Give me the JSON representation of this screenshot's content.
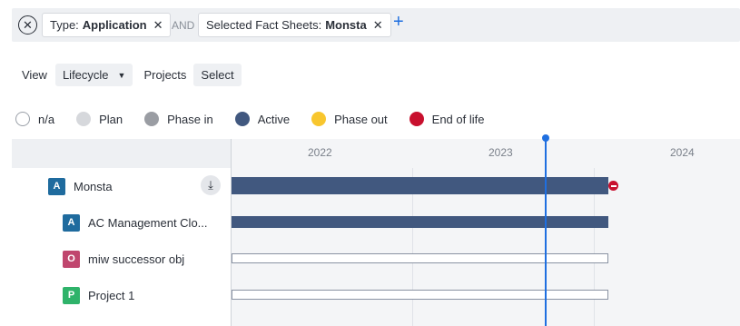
{
  "filters": {
    "chips": [
      {
        "prefix": "Type:",
        "value": "Application"
      },
      {
        "prefix": "Selected Fact Sheets:",
        "value": "Monsta"
      }
    ],
    "and_label": "AND",
    "clear_icon": "✕",
    "remove_icon": "✕",
    "add_icon": "+"
  },
  "view": {
    "view_label": "View",
    "view_value": "Lifecycle",
    "projects_label": "Projects",
    "projects_value": "Select"
  },
  "legend": [
    {
      "label": "n/a",
      "color": "#ffffff",
      "border": "#9aa0a8"
    },
    {
      "label": "Plan",
      "color": "#d6d8dc"
    },
    {
      "label": "Phase in",
      "color": "#9a9da3"
    },
    {
      "label": "Active",
      "color": "#41587f"
    },
    {
      "label": "Phase out",
      "color": "#f8c62e"
    },
    {
      "label": "End of life",
      "color": "#c8102e"
    }
  ],
  "timeline": {
    "years": [
      "2022",
      "2023",
      "2024"
    ],
    "rows": [
      {
        "badge": "A",
        "badge_color": "#1f6b9e",
        "name": "Monsta",
        "status": "Active"
      },
      {
        "badge": "A",
        "badge_color": "#1f6b9e",
        "name": "AC Management Clo...",
        "status": "Active"
      },
      {
        "badge": "O",
        "badge_color": "#c0466e",
        "name": "miw successor obj",
        "status": "n/a"
      },
      {
        "badge": "P",
        "badge_color": "#2fb36a",
        "name": "Project 1",
        "status": "n/a"
      }
    ],
    "sort_icon": "⤓"
  }
}
